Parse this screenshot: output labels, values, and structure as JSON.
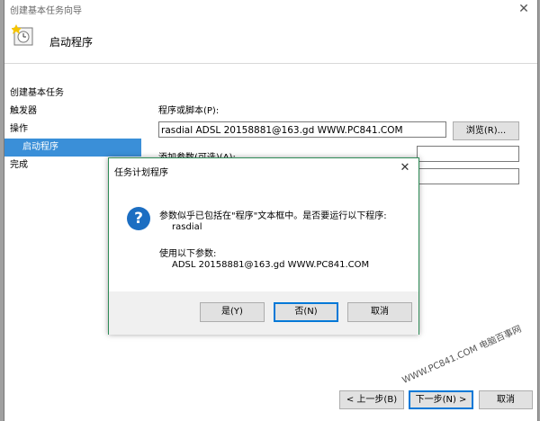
{
  "window": {
    "title": "创建基本任务向导",
    "close_glyph": "✕"
  },
  "header": {
    "icon": "clock-task-icon",
    "title": "启动程序"
  },
  "nav": {
    "items": [
      {
        "label": "创建基本任务"
      },
      {
        "label": "触发器"
      },
      {
        "label": "操作"
      },
      {
        "label": "启动程序"
      },
      {
        "label": "完成"
      }
    ],
    "active_index": 3
  },
  "form": {
    "program_label": "程序或脚本(P):",
    "program_value": "rasdial ADSL 20158881@163.gd WWW.PC841.COM",
    "browse_label": "浏览(R)...",
    "args_label": "添加参数(可选)(A):"
  },
  "footer": {
    "back_label": "< 上一步(B)",
    "next_label": "下一步(N) >",
    "cancel_label": "取消"
  },
  "watermark": "WWW.PC841.COM 电脑百事网",
  "dialog": {
    "title": "任务计划程序",
    "close_glyph": "✕",
    "icon": "question-icon",
    "icon_glyph": "?",
    "message": "参数似乎已包括在\"程序\"文本框中。是否要运行以下程序:",
    "program": "rasdial",
    "args_intro": "使用以下参数:",
    "args": "ADSL 20158881@163.gd WWW.PC841.COM",
    "yes_label": "是(Y)",
    "no_label": "否(N)",
    "cancel_label": "取消"
  },
  "colors": {
    "accent": "#3a8fd8",
    "dialog_border": "#2e8b57",
    "question_icon": "#1c6ec2"
  }
}
